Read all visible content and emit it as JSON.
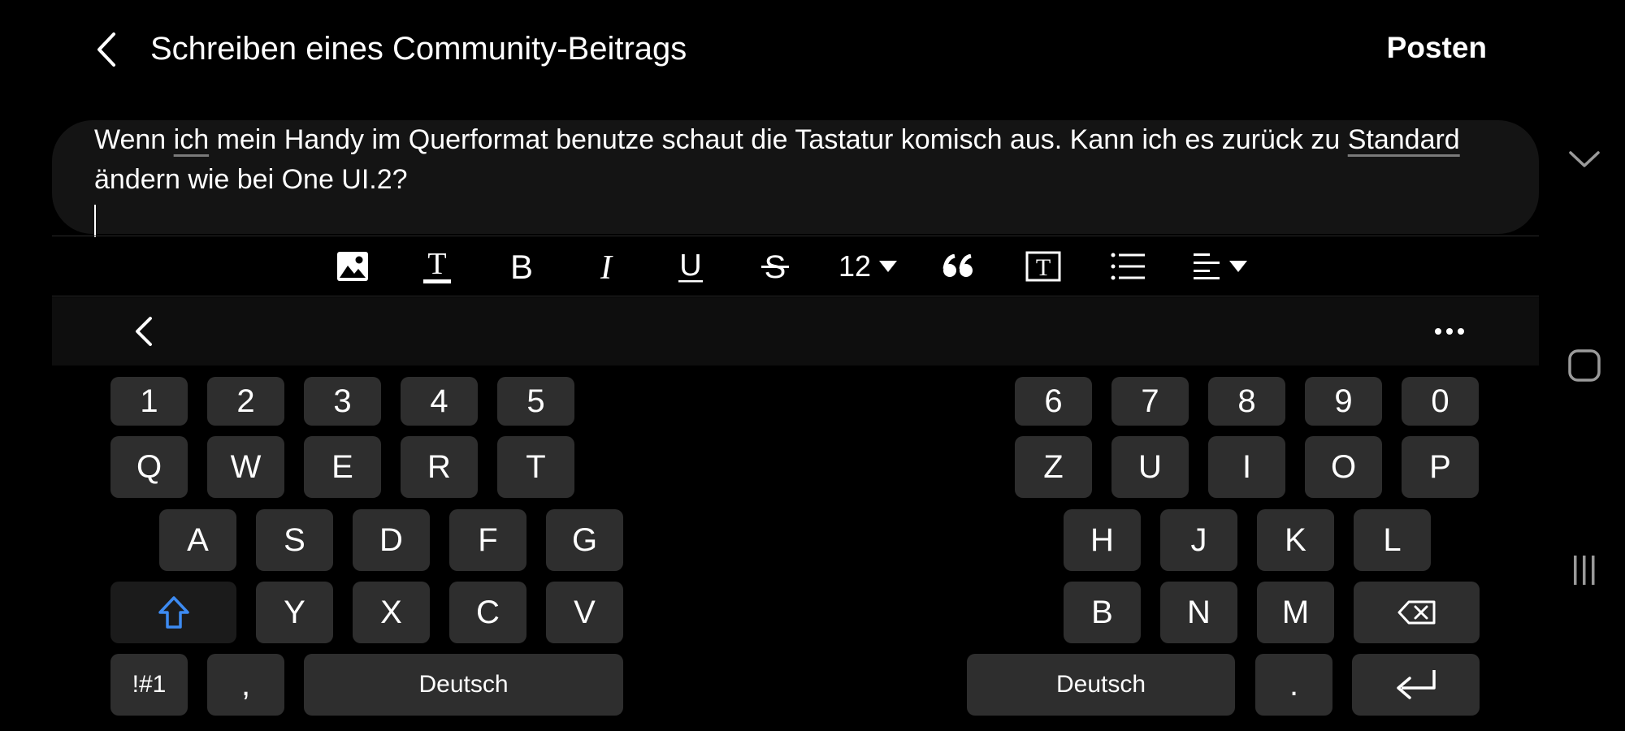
{
  "header": {
    "title": "Schreiben eines Community-Beitrags",
    "post_label": "Posten",
    "back_icon": "chevron-left-icon"
  },
  "editor": {
    "line1_pre": "Wenn ",
    "line1_u1": "ich",
    "line1_mid": " mein Handy im Querformat benutze schaut die Tastatur komisch aus. Kann ich es zurück zu ",
    "line1_u2": "Standard",
    "line2": "ändern wie bei One UI.2?"
  },
  "toolbar": {
    "font_size": "12",
    "icons": [
      "image-icon",
      "text-color-icon",
      "bold-icon",
      "italic-icon",
      "underline-icon",
      "strikethrough-icon",
      "font-size-dropdown",
      "quote-icon",
      "text-box-icon",
      "bullet-list-icon",
      "align-dropdown"
    ]
  },
  "keyboard": {
    "numbers_left": [
      "1",
      "2",
      "3",
      "4",
      "5"
    ],
    "numbers_right": [
      "6",
      "7",
      "8",
      "9",
      "0"
    ],
    "row1_left": [
      "Q",
      "W",
      "E",
      "R",
      "T"
    ],
    "row1_right": [
      "Z",
      "U",
      "I",
      "O",
      "P"
    ],
    "row2_left": [
      "A",
      "S",
      "D",
      "F",
      "G"
    ],
    "row2_right": [
      "H",
      "J",
      "K",
      "L"
    ],
    "row3_left": [
      "Y",
      "X",
      "C",
      "V"
    ],
    "row3_right": [
      "B",
      "N",
      "M"
    ],
    "symbols_label": "!#1",
    "comma": ",",
    "space_left": "Deutsch",
    "space_right": "Deutsch",
    "period": ".",
    "shift_color": "#3d8bf2"
  },
  "system_nav": {
    "icons": [
      "hide-keyboard-icon",
      "home-icon",
      "recent-apps-icon"
    ]
  }
}
